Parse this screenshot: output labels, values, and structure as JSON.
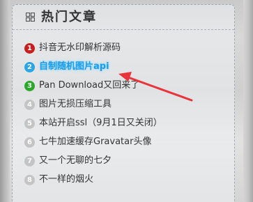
{
  "widget": {
    "title": "热门文章",
    "title_icon": "grid-icon",
    "items": [
      {
        "rank": "1",
        "title": "抖音无水印解析源码",
        "badge_color": "#c81e1e"
      },
      {
        "rank": "2",
        "title": "自制随机图片api",
        "badge_color": "#2aa6e6",
        "active": true
      },
      {
        "rank": "3",
        "title": "Pan Download又回来了",
        "badge_color": "#2aa82a"
      },
      {
        "rank": "4",
        "title": "图片无损压缩工具",
        "badge_color": "#c4c4c4"
      },
      {
        "rank": "5",
        "title": "本站开启ssl（9月1日又关闭）",
        "badge_color": "#c4c4c4"
      },
      {
        "rank": "6",
        "title": "七牛加速缓存Gravatar头像",
        "badge_color": "#c4c4c4"
      },
      {
        "rank": "7",
        "title": "又一个无聊的七夕",
        "badge_color": "#c4c4c4"
      },
      {
        "rank": "8",
        "title": "不一样的烟火",
        "badge_color": "#c4c4c4"
      }
    ]
  },
  "annotation": {
    "arrow_color": "#e8343a"
  }
}
